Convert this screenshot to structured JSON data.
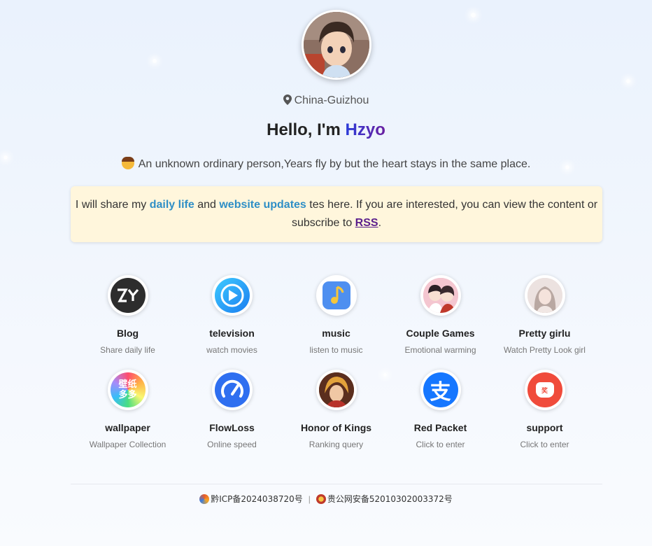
{
  "profile": {
    "location": "China-Guizhou",
    "greeting_prefix": "Hello, I'm ",
    "name": "Hzyo",
    "motto": "An unknown ordinary person,Years fly by but the heart stays in the same place."
  },
  "notice": {
    "text1": "I will share my ",
    "link1": "daily life",
    "text2": " and ",
    "link2": "website updates",
    "text3": " tes here. If you are interested, you can view the content or subscribe to ",
    "rss": "RSS",
    "text4": "."
  },
  "tiles": [
    {
      "title": "Blog",
      "sub": "Share daily life",
      "icon": "zy-logo-icon"
    },
    {
      "title": "television",
      "sub": "watch movies",
      "icon": "play-icon"
    },
    {
      "title": "music",
      "sub": "listen to music",
      "icon": "music-note-icon"
    },
    {
      "title": "Couple Games",
      "sub": "Emotional warming",
      "icon": "couple-avatar-icon"
    },
    {
      "title": "Pretty girlu",
      "sub": "Watch Pretty Look girl",
      "icon": "girl-avatar-icon"
    },
    {
      "title": "wallpaper",
      "sub": "Wallpaper Collection",
      "icon": "wallpaper-icon",
      "glyph_top": "壁纸",
      "glyph_bottom": "多多"
    },
    {
      "title": "FlowLoss",
      "sub": "Online speed",
      "icon": "speedometer-icon"
    },
    {
      "title": "Honor of Kings",
      "sub": "Ranking query",
      "icon": "game-hero-icon"
    },
    {
      "title": "Red Packet",
      "sub": "Click to enter",
      "icon": "alipay-icon",
      "glyph": "支"
    },
    {
      "title": "support",
      "sub": "Click to enter",
      "icon": "red-pouch-icon",
      "glyph": "奖"
    }
  ],
  "footer": {
    "icp": "黔ICP备2024038720号",
    "separator": "|",
    "police": "贵公网安备52010302003372号"
  },
  "colors": {
    "accent_link": "#2f8fc6",
    "rss": "#5a1e8c",
    "notice_bg": "#fff6dc"
  }
}
